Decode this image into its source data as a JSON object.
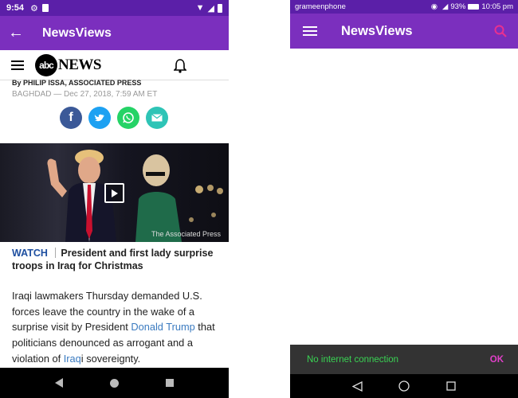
{
  "left_phone": {
    "status": {
      "time": "9:54"
    },
    "appbar": {
      "title": "NewsViews"
    },
    "site_header": {
      "brand": "NEWS",
      "logo_text": "abc"
    },
    "article": {
      "byline": "By PHILIP ISSA, ASSOCIATED PRESS",
      "dateline": "BAGHDAD — Dec 27, 2018, 7:59 AM ET",
      "video_credit": "The Associated Press",
      "watch_label": "WATCH",
      "video_title": "President and first lady surprise troops in Iraq for Christmas",
      "body_1": "Iraqi lawmakers Thursday demanded U.S. forces leave the country in the wake of a surprise visit by President ",
      "body_link_1": "Donald Trump",
      "body_2": " that politicians denounced as arrogant and a violation of ",
      "body_link_2": "Iraq",
      "body_3": "i sovereignty."
    }
  },
  "right_phone": {
    "status": {
      "carrier": "grameenphone",
      "battery": "93%",
      "time": "10:05 pm"
    },
    "appbar": {
      "title": "NewsViews"
    },
    "snackbar": {
      "message": "No internet connection",
      "action": "OK"
    }
  },
  "colors": {
    "appbar": "#7b2fbe",
    "statusbar": "#5b1fa8",
    "link": "#3b7bc0",
    "snackbar_text": "#39d353",
    "snackbar_action": "#e040c8"
  }
}
